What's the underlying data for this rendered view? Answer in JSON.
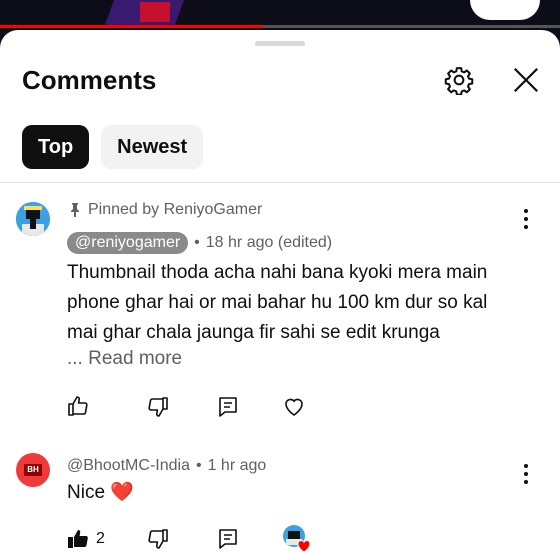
{
  "player": {
    "progress_fraction": 0.47,
    "accent_color": "#ff0000"
  },
  "panel": {
    "title": "Comments"
  },
  "header_icons": [
    "settings-icon",
    "close-icon"
  ],
  "tabs": [
    {
      "label": "Top",
      "active": true
    },
    {
      "label": "Newest",
      "active": false
    }
  ],
  "comments": [
    {
      "pinned_label": "Pinned by ReniyoGamer",
      "author": "@reniyogamer",
      "time": "18 hr ago (edited)",
      "text_lines": [
        "Thumbnail thoda acha nahi bana kyoki mera main",
        "phone ghar hai or mai bahar hu 100 km dur so kal",
        "mai ghar chala jaunga fir sahi se edit krunga"
      ],
      "read_more": "... Read more",
      "like_count": ""
    },
    {
      "avatar_text": "BH",
      "author": "@BhootMC-India",
      "time": "1 hr ago",
      "text": "Nice ❤️",
      "like_count": "2"
    }
  ]
}
